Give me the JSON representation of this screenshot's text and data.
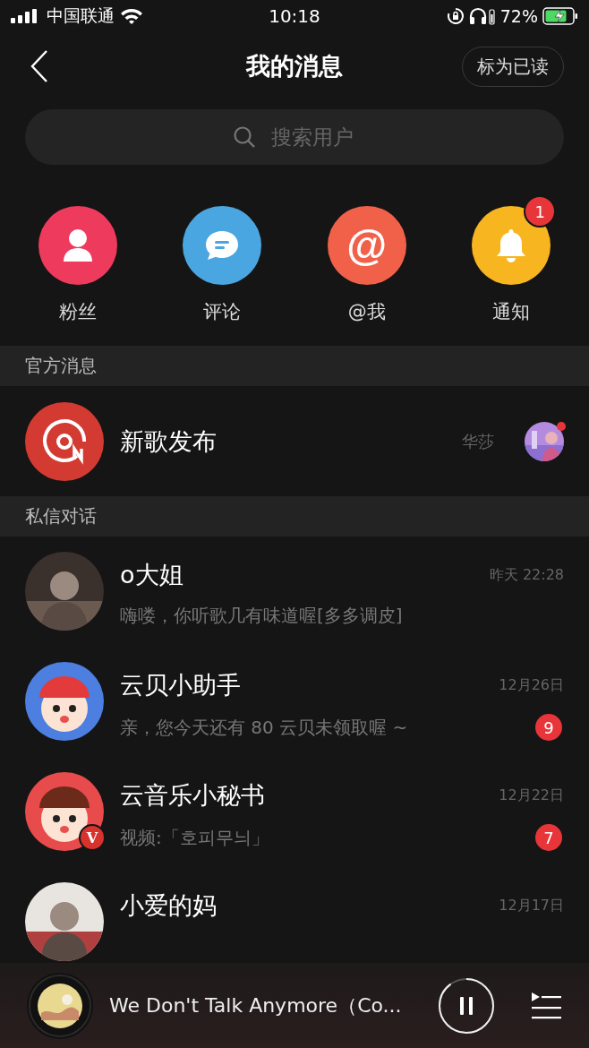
{
  "status_bar": {
    "carrier": "中国联通",
    "time": "10:18",
    "battery": "72%"
  },
  "header": {
    "title": "我的消息",
    "mark_read": "标为已读"
  },
  "search": {
    "placeholder": "搜索用户"
  },
  "quick_actions": [
    {
      "label": "粉丝",
      "kind": "person",
      "color": "#ee3a5c"
    },
    {
      "label": "评论",
      "kind": "comment",
      "color": "#4aa6e0"
    },
    {
      "label": "@我",
      "kind": "at",
      "color": "#f1614a",
      "glyph": "@"
    },
    {
      "label": "通知",
      "kind": "bell",
      "color": "#f7b51f",
      "badge": "1"
    }
  ],
  "official": {
    "heading": "官方消息",
    "title": "新歌发布",
    "artist": "华莎",
    "unread_dot": true
  },
  "private": {
    "heading": "私信对话",
    "conversations": [
      {
        "name": "o大姐",
        "time": "昨天 22:28",
        "preview": "嗨喽，你听歌几有味道喔[多多调皮]"
      },
      {
        "name": "云贝小助手",
        "time": "12月26日",
        "preview": "亲，您今天还有 80 云贝未领取喔 ~",
        "badge": "9"
      },
      {
        "name": "云音乐小秘书",
        "time": "12月22日",
        "preview": "视频:「호피무늬」",
        "badge": "7",
        "verified": "V"
      },
      {
        "name": "小爱的妈",
        "time": "12月17日"
      }
    ]
  },
  "player": {
    "title": "We Don't Talk Anymore（Co..."
  }
}
